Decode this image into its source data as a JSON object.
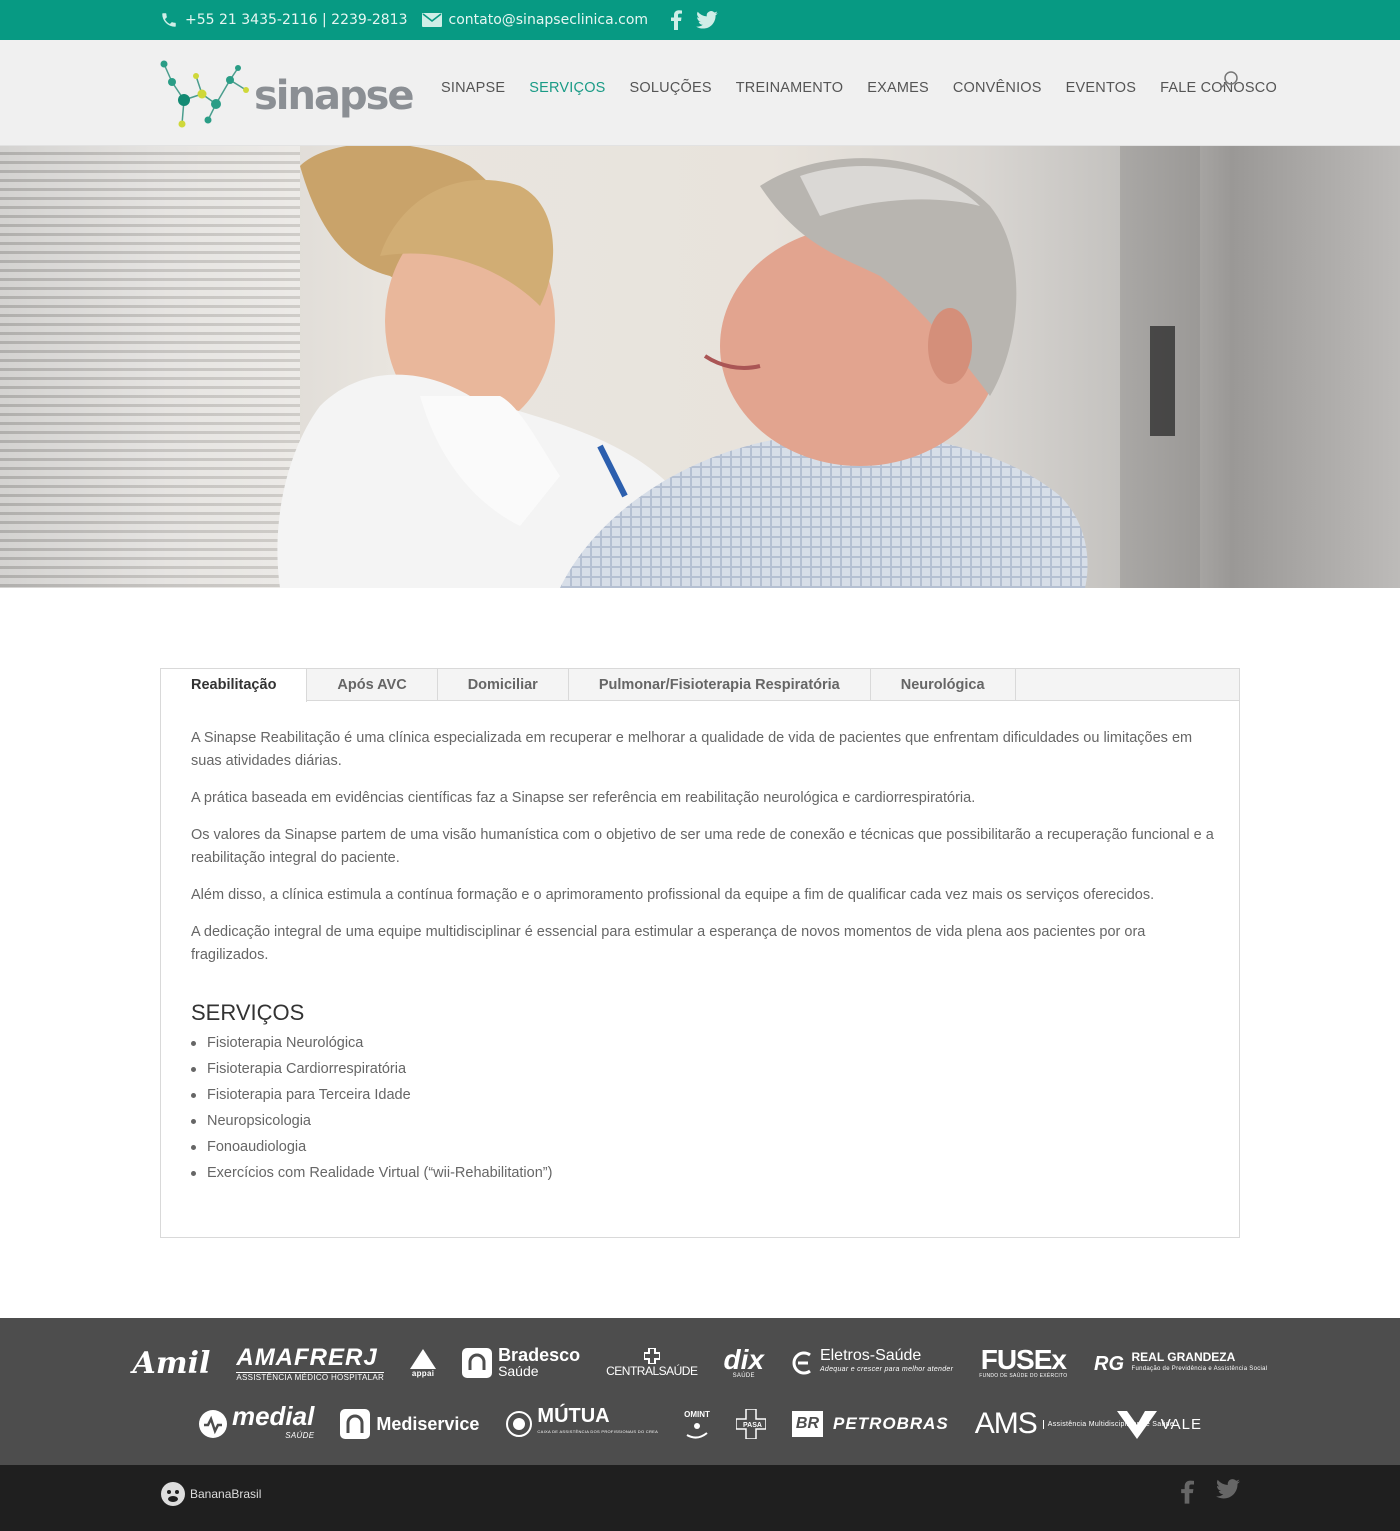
{
  "topbar": {
    "phone": "+55 21 3435-2116 | 2239-2813",
    "email": "contato@sinapseclinica.com",
    "icons": [
      "phone-icon",
      "mail-icon",
      "facebook-icon",
      "twitter-icon"
    ]
  },
  "header": {
    "logo_text": "sinapse",
    "nav": [
      {
        "label": "SINAPSE"
      },
      {
        "label": "SERVIÇOS",
        "active": true
      },
      {
        "label": "SOLUÇÕES"
      },
      {
        "label": "TREINAMENTO"
      },
      {
        "label": "EXAMES"
      },
      {
        "label": "CONVÊNIOS"
      },
      {
        "label": "EVENTOS"
      },
      {
        "label": "FALE CONOSCO"
      }
    ]
  },
  "tabs": {
    "items": [
      {
        "label": "Reabilitação",
        "active": true
      },
      {
        "label": "Após AVC"
      },
      {
        "label": "Domiciliar"
      },
      {
        "label": "Pulmonar/Fisioterapia Respiratória"
      },
      {
        "label": "Neurológica"
      }
    ],
    "paragraphs": [
      "A Sinapse Reabilitação é uma clínica especializada em recuperar e melhorar a qualidade de vida de pacientes que enfrentam dificuldades ou limitações em suas atividades diárias.",
      "A prática baseada em evidências científicas faz a Sinapse ser referência em reabilitação neurológica e cardiorrespiratória.",
      "Os valores da Sinapse partem de uma visão humanística com o objetivo de ser uma rede de conexão e técnicas que possibilitarão a recuperação funcional e a reabilitação integral do paciente.",
      "Além disso, a clínica estimula a contínua formação e o aprimoramento profissional da equipe a fim de qualificar cada vez mais os serviços oferecidos.",
      "A dedicação integral de uma equipe multidisciplinar é essencial para estimular a esperança de novos momentos de vida plena aos pacientes por ora fragilizados."
    ],
    "services_title": "SERVIÇOS",
    "services": [
      "Fisioterapia Neurológica",
      "Fisioterapia Cardiorrespiratória",
      "Fisioterapia para Terceira Idade",
      "Neuropsicologia",
      "Fonoaudiologia",
      "Exercícios com Realidade Virtual (“wii-Rehabilitation”)"
    ]
  },
  "partners": {
    "row1": [
      "Amil",
      "AMAFRERJ",
      "appai",
      "Bradesco",
      "CENTRALSAÚDE",
      "dix",
      "Eletros-Saúde",
      "FUSEx",
      "REAL GRANDEZA"
    ],
    "row1_sub": {
      "amafrerj": "ASSISTÊNCIA MÉDICO HOSPITALAR",
      "bradesco": "Saúde",
      "dix": "SAÚDE",
      "eletros": "Adequar e crescer para melhor atender",
      "fusex": "FUNDO DE SAÚDE DO EXÉRCITO",
      "realgrandeza": "Fundação de Previdência e Assistência Social"
    },
    "row2": [
      "medial",
      "Mediservice",
      "MÚTUA",
      "OMINT",
      "PASA",
      "PETROBRAS",
      "AMS",
      "VALE"
    ],
    "row2_sub": {
      "medial": "SAÚDE",
      "mutua": "CAIXA DE ASSISTÊNCIA DOS PROFISSIONAIS DO CREA",
      "ams": "Assistência Multidisciplinar de Saúde",
      "br": "BR"
    }
  },
  "footer": {
    "brand": "BananaBrasil"
  },
  "colors": {
    "teal": "#079a83",
    "nav_active": "#1a9b86",
    "partners_bg": "#4d4d4d",
    "footer_bg": "#1f1f1f"
  }
}
